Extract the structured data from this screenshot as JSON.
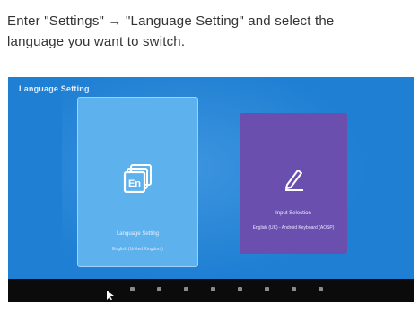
{
  "instruction": {
    "line1": "Enter \"Settings\" → \"Language Setting\" and select the",
    "line2": "language you want to switch."
  },
  "screen": {
    "title": "Language Setting",
    "background": "#1f7fd3",
    "tiles": [
      {
        "label": "Language Setting",
        "sub": "English (United Kingdom)",
        "icon": "language-en-icon",
        "color": "#5db1ec"
      },
      {
        "label": "Input Selection",
        "sub": "English (UK) - Android Keyboard (AOSP)",
        "icon": "pen-icon",
        "color": "#6a4fae"
      }
    ],
    "navbar": {
      "icons": [
        "back-icon",
        "home-icon",
        "recents-icon",
        "screenshot-icon",
        "volume-down-icon",
        "volume-up-icon",
        "menu-icon",
        "settings-icon"
      ]
    }
  }
}
